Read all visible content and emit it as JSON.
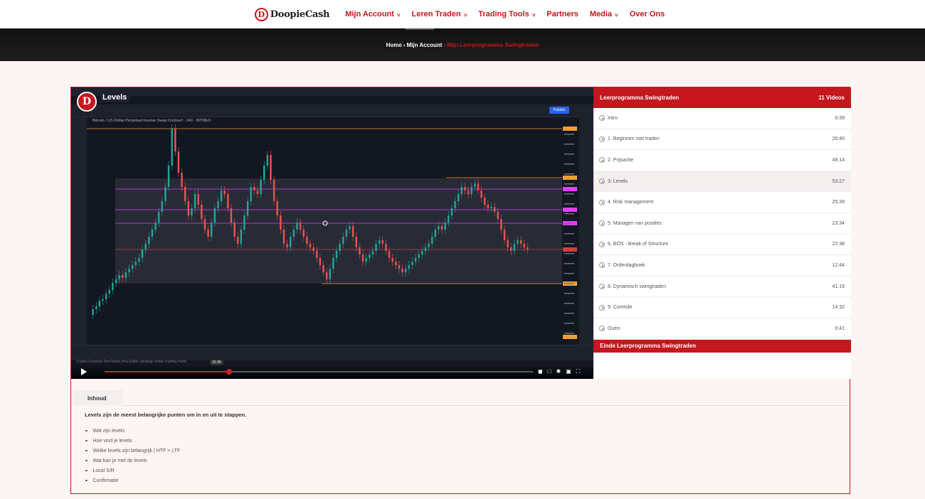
{
  "nav": {
    "logo_text": "DoopieCash",
    "logo_mark": "D",
    "items": [
      {
        "label": "Mijn Account",
        "has_dropdown": true
      },
      {
        "label": "Leren Traden",
        "has_dropdown": true
      },
      {
        "label": "Trading Tools",
        "has_dropdown": true
      },
      {
        "label": "Partners",
        "has_dropdown": false
      },
      {
        "label": "Media",
        "has_dropdown": true
      },
      {
        "label": "Over Ons",
        "has_dropdown": false
      }
    ]
  },
  "breadcrumb": {
    "home": "Home",
    "account": "Mijn Account",
    "current": "Mijn Leerprogramma Swingtraden"
  },
  "video": {
    "title": "Levels",
    "logo_mark": "D",
    "symbol_line": "Bitcoin / US Dollar Perpetual Inverse Swap Contract · 240 · BITMEX",
    "publish_label": "Publish",
    "time_tooltip": "15:36",
    "progress_fraction": 0.29,
    "bottom_tabs": "Crypto Screener   Text Notes   Pine Editor   Strategy Tester   Trading Panel"
  },
  "playlist": {
    "title": "Leerprogramma Swingtraden",
    "count_label": "11 Videos",
    "items": [
      {
        "label": "Intro",
        "duration": "0:39"
      },
      {
        "label": "1. Beginnen met traden",
        "duration": "26:40"
      },
      {
        "label": "2. Prijsactie",
        "duration": "49:14"
      },
      {
        "label": "3. Levels",
        "duration": "53:27"
      },
      {
        "label": "4. Risk management",
        "duration": "25:39"
      },
      {
        "label": "5. Managen van posities",
        "duration": "23:34"
      },
      {
        "label": "6. BOS - Break of Structure",
        "duration": "22:38"
      },
      {
        "label": "7. Orderdagboek",
        "duration": "12:44"
      },
      {
        "label": "8. Dynamisch swingtraden",
        "duration": "41:19"
      },
      {
        "label": "9. Controle",
        "duration": "14:32"
      },
      {
        "label": "Outro",
        "duration": "0:41"
      }
    ],
    "active_index": 3,
    "footer": "Einde Leerprogramma Swingtraden"
  },
  "content": {
    "tab_label": "Inhoud",
    "intro": "Levels zijn de meest belangrijke punten om in en uit te stappen.",
    "bullets": [
      "Wat zijn levels",
      "Hoe vind je levels",
      "Welke levels zijn belangrijk | HTF > LTF",
      "Wat kan je met de levels",
      "Local S/R",
      "Confirmatie"
    ]
  },
  "colors": {
    "brand_red": "#c5171d",
    "chart_bg": "#131722",
    "candle_up": "#26a69a",
    "candle_down": "#ef5350",
    "level_magenta": "#e040fb",
    "level_orange": "#f0a030"
  }
}
